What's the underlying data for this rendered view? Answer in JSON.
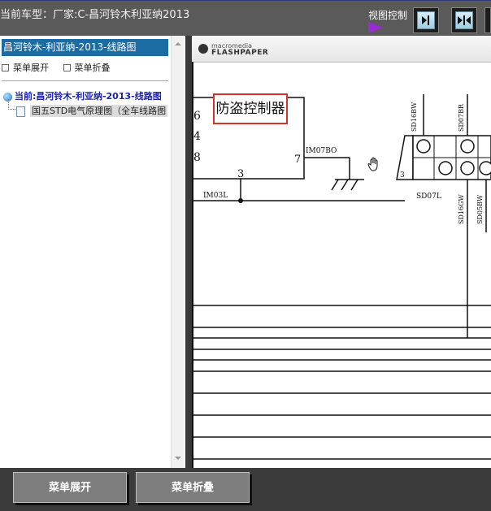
{
  "header": {
    "car_type_label": "当前车型：厂家:C-昌河铃木利亚纳2013",
    "view_control_label": "视图控制",
    "view_buttons": [
      "collapse-left-icon",
      "split-view-icon",
      "expand-right-icon"
    ]
  },
  "tree": {
    "title": "昌河铃木-利亚纳-2013-线路图",
    "expand_label": "菜单展开",
    "collapse_label": "菜单折叠",
    "root_label": "当前:昌河铃木-利亚纳-2013-线路图",
    "child_label": "国五STD电气原理图（全车线路图"
  },
  "viewer": {
    "brand_top": "macromedia",
    "brand_bottom": "FLASHPAPER",
    "diagram": {
      "controller_label": "防盗控制器",
      "pin_numbers": [
        "6",
        "4",
        "8",
        "3",
        "7"
      ],
      "wire_labels": [
        "IM07BO",
        "IM03L",
        "SD07L",
        "SD16BW",
        "SD07BR",
        "SD16GW",
        "SD05BW"
      ]
    }
  },
  "footer": {
    "expand_button": "菜单展开",
    "collapse_button": "菜单折叠"
  },
  "colors": {
    "accent": "#1c6ca4",
    "highlight_box": "#d9302a",
    "arrow": "#9a2bd6"
  }
}
